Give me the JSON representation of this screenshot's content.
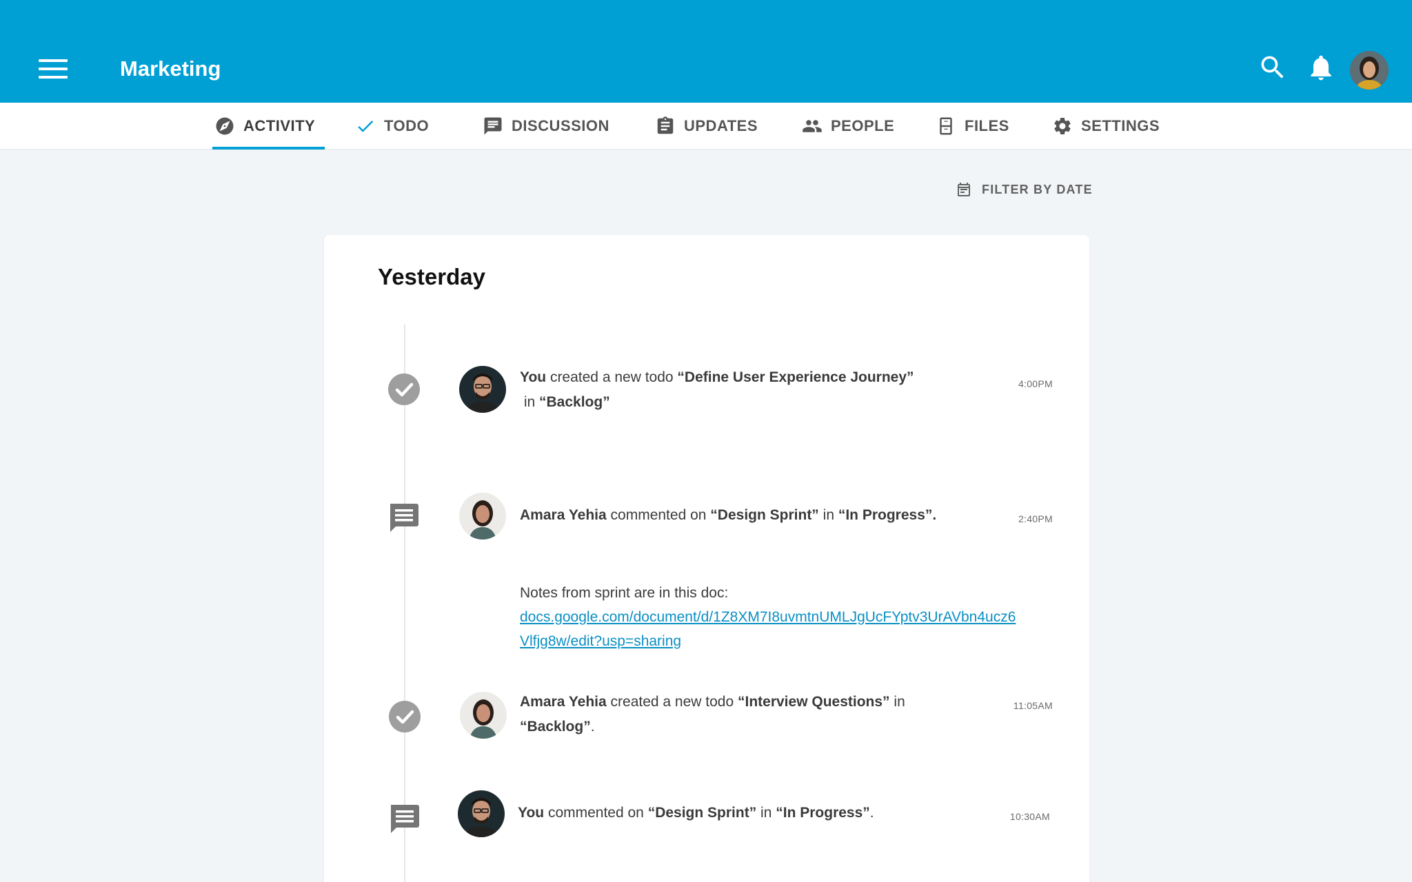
{
  "header": {
    "title": "Marketing",
    "menu_icon": "hamburger-menu-icon",
    "search_icon": "search-icon",
    "bell_icon": "bell-icon",
    "brand_color": "#009fd4"
  },
  "tabs": [
    {
      "label": "ACTIVITY",
      "icon": "compass-icon",
      "active": true
    },
    {
      "label": "TODO",
      "icon": "check-icon"
    },
    {
      "label": "DISCUSSION",
      "icon": "chat-icon"
    },
    {
      "label": "UPDATES",
      "icon": "clipboard-icon"
    },
    {
      "label": "PEOPLE",
      "icon": "people-icon"
    },
    {
      "label": "FILES",
      "icon": "file-cabinet-icon"
    },
    {
      "label": "SETTINGS",
      "icon": "gear-icon"
    }
  ],
  "filter": {
    "label": "FILTER BY DATE",
    "icon": "calendar-icon"
  },
  "feed": {
    "section_title": "Yesterday",
    "entries": [
      {
        "type": "todo",
        "actor": "You",
        "action": " created a new todo ",
        "item": "“Define User Experience Journey”",
        "preposition": " in ",
        "location": "“Backlog”",
        "suffix": "",
        "time": "4:00PM"
      },
      {
        "type": "comment",
        "actor": "Amara Yehia",
        "action": " commented on ",
        "item": "“Design Sprint”",
        "preposition": " in ",
        "location": "“In Progress”.",
        "suffix": "",
        "time": "2:40PM",
        "comment_text": "Notes from sprint are in this doc:",
        "comment_link": "docs.google.com/document/d/1Z8XM7I8uvmtnUMLJgUcFYptv3UrAVbn4ucz6Vlfjg8w/edit?usp=sharing"
      },
      {
        "type": "todo",
        "actor": "Amara Yehia",
        "action": " created a new todo ",
        "item": "“Interview Questions”",
        "preposition": " in ",
        "location": "“Backlog”",
        "suffix": ".",
        "time": "11:05AM"
      },
      {
        "type": "comment",
        "actor": "You",
        "action": " commented on ",
        "item": "“Design Sprint”",
        "preposition": " in ",
        "location": "“In Progress”",
        "suffix": ".",
        "time": "10:30AM"
      }
    ]
  }
}
